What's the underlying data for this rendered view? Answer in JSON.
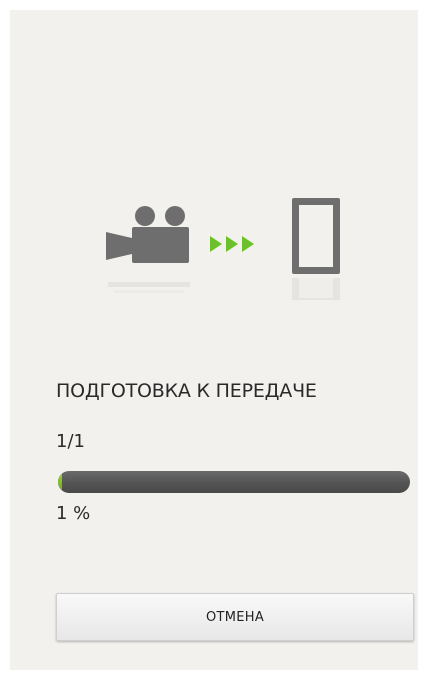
{
  "illustration": {
    "source_icon": "video-camera-icon",
    "transfer_icon": "arrows-icon",
    "target_icon": "smartphone-icon",
    "arrow_color": "#6cc02a",
    "icon_color": "#6e6e6e"
  },
  "status": {
    "title": "ПОДГОТОВКА К ПЕРЕДАЧЕ",
    "counter": "1/1",
    "progress_fraction": 0.01,
    "percent_label": "1 %"
  },
  "buttons": {
    "cancel_label": "ОТМЕНА"
  },
  "colors": {
    "background": "#f3f1ee",
    "progress_track": "#555555",
    "progress_fill": "#7bb826"
  }
}
